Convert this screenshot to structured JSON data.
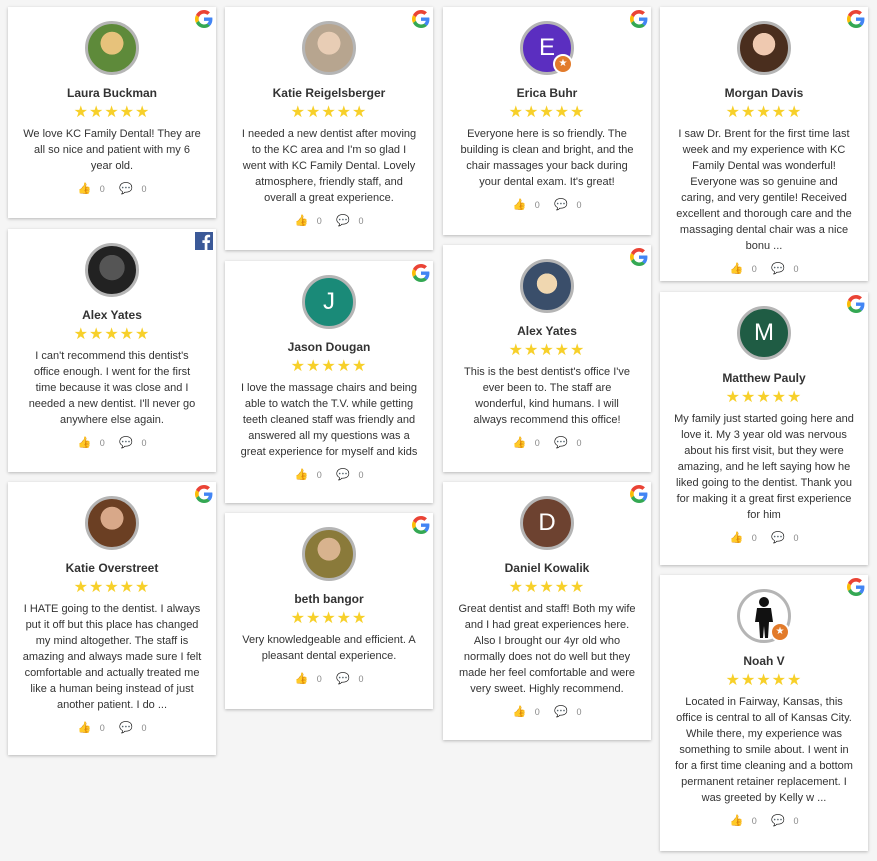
{
  "icons": {
    "google": "google-g-icon",
    "facebook": "facebook-f-icon",
    "like": "thumbs-up-icon",
    "comment": "comment-bubble-icon"
  },
  "colors": {
    "star": "#f7d02a",
    "google_blue": "#4285F4",
    "google_red": "#EA4335",
    "google_yellow": "#FBBC05",
    "google_green": "#34A853",
    "facebook": "#3b5998"
  },
  "reviews": [
    {
      "name": "Laura Buckman",
      "stars": "★★★★★",
      "text": "We love KC Family Dental! They are all so nice and patient with my 6 year old.",
      "likes": "0",
      "comments": "0",
      "source": "google"
    },
    {
      "name": "Alex Yates",
      "stars": "★★★★★",
      "text": "I can't recommend this dentist's office enough. I went for the first time because it was close and I needed a new dentist. I'll never go anywhere else again.",
      "likes": "0",
      "comments": "0",
      "source": "facebook"
    },
    {
      "name": "Katie Overstreet",
      "stars": "★★★★★",
      "text": "I HATE going to the dentist. I always put it off but this place has changed my mind altogether. The staff is amazing and always made sure I felt comfortable and actually treated me like a human being instead of just another patient. I do ...",
      "likes": "0",
      "comments": "0",
      "source": "google"
    },
    {
      "name": "Katie Reigelsberger",
      "stars": "★★★★★",
      "text": "I needed a new dentist after moving to the KC area and I'm so glad I went with KC Family Dental. Lovely atmosphere, friendly staff, and overall a great experience.",
      "likes": "0",
      "comments": "0",
      "source": "google"
    },
    {
      "name": "Jason Dougan",
      "letter": "J",
      "stars": "★★★★★",
      "text": "I love the massage chairs and being able to watch the T.V. while getting teeth cleaned staff was friendly and answered all my questions was a great experience for myself and kids",
      "likes": "0",
      "comments": "0",
      "source": "google"
    },
    {
      "name": "beth bangor",
      "stars": "★★★★★",
      "text": "Very knowledgeable and efficient. A pleasant dental experience.",
      "likes": "0",
      "comments": "0",
      "source": "google"
    },
    {
      "name": "Erica Buhr",
      "letter": "E",
      "stars": "★★★★★",
      "text": "Everyone here is so friendly. The building is clean and bright, and the chair massages your back during your dental exam. It's great!",
      "likes": "0",
      "comments": "0",
      "source": "google"
    },
    {
      "name": "Alex Yates",
      "stars": "★★★★★",
      "text": "This is the best dentist's office I've ever been to. The staff are wonderful, kind humans. I will always recommend this office!",
      "likes": "0",
      "comments": "0",
      "source": "google"
    },
    {
      "name": "Daniel Kowalik",
      "letter": "D",
      "stars": "★★★★★",
      "text": "Great dentist and staff! Both my wife and I had great experiences here. Also I brought our 4yr old who normally does not do well but they made her feel comfortable and were very sweet. Highly recommend.",
      "likes": "0",
      "comments": "0",
      "source": "google"
    },
    {
      "name": "Morgan Davis",
      "stars": "★★★★★",
      "text": "I saw Dr. Brent for the first time last week and my experience with KC Family Dental was wonderful! Everyone was so genuine and caring, and very gentile! Received excellent and thorough care and the massaging dental chair was a nice bonu ...",
      "likes": "0",
      "comments": "0",
      "source": "google"
    },
    {
      "name": "Matthew Pauly",
      "letter": "M",
      "stars": "★★★★★",
      "text": "My family just started going here and love it. My 3 year old was nervous about his first visit, but they were amazing, and he left saying how he liked going to the dentist. Thank you for making it a great first experience for him",
      "likes": "0",
      "comments": "0",
      "source": "google"
    },
    {
      "name": "Noah V",
      "stars": "★★★★★",
      "text": "Located in Fairway, Kansas, this office is central to all of Kansas City. While there, my experience was something to smile about. I went in for a first time cleaning and a bottom permanent retainer replacement. I was greeted by Kelly w ...",
      "likes": "0",
      "comments": "0",
      "source": "google"
    }
  ]
}
